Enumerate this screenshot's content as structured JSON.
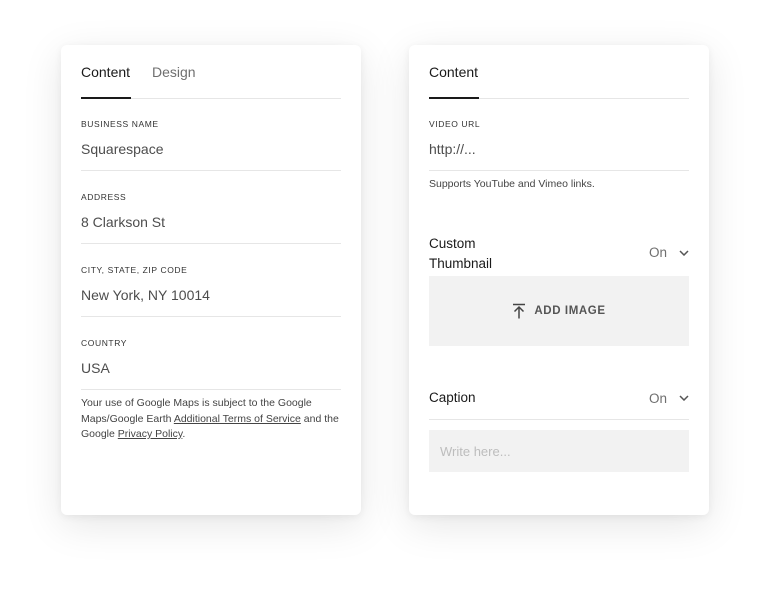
{
  "left_panel": {
    "tabs": [
      {
        "label": "Content",
        "active": true
      },
      {
        "label": "Design",
        "active": false
      }
    ],
    "fields": [
      {
        "label": "BUSINESS NAME",
        "value": "Squarespace"
      },
      {
        "label": "ADDRESS",
        "value": "8 Clarkson St"
      },
      {
        "label": "CITY, STATE, ZIP CODE",
        "value": "New York, NY 10014"
      },
      {
        "label": "COUNTRY",
        "value": "USA"
      }
    ],
    "note": {
      "text_1": "Your use of Google Maps is subject to the Google Maps/Google Earth ",
      "link_1": "Additional Terms of Service",
      "text_2": " and the Google ",
      "link_2": "Privacy Policy",
      "text_3": "."
    }
  },
  "right_panel": {
    "tabs": [
      {
        "label": "Content",
        "active": true
      }
    ],
    "video_url": {
      "label": "VIDEO URL",
      "value": "http://...",
      "hint": "Supports YouTube and Vimeo links."
    },
    "custom_thumbnail": {
      "label_line1": "Custom",
      "label_line2": "Thumbnail",
      "toggle": "On",
      "add_image_label": "ADD IMAGE"
    },
    "caption": {
      "label": "Caption",
      "toggle": "On",
      "placeholder": "Write here..."
    }
  },
  "icons": {
    "chevron": "chevron-down-icon",
    "upload": "upload-icon"
  }
}
